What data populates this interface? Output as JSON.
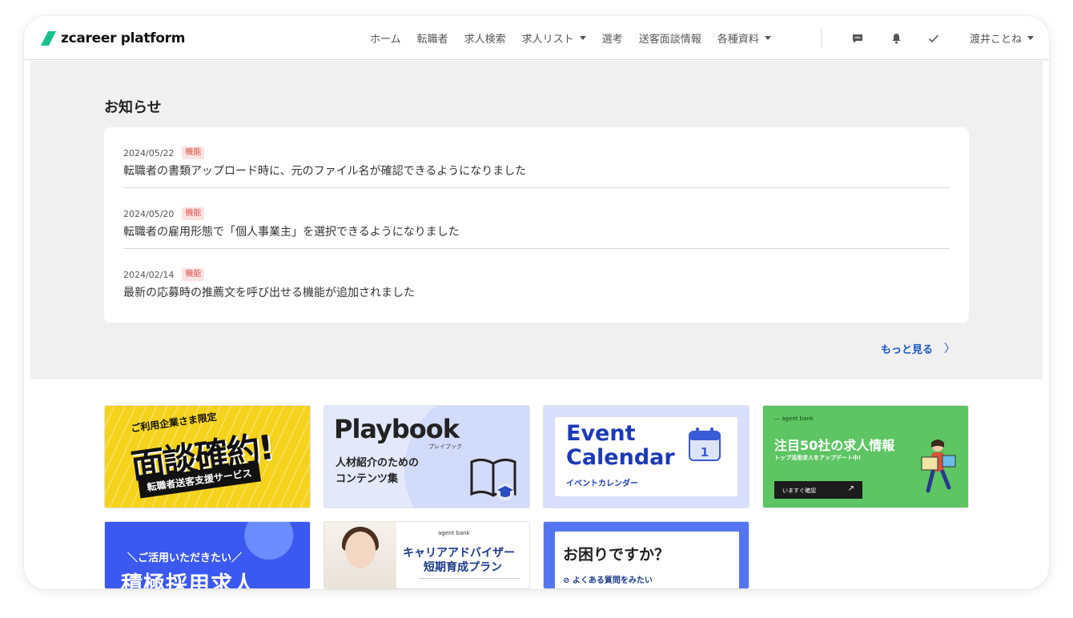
{
  "header": {
    "logo_text": "zcareer platform",
    "nav": [
      "ホーム",
      "転職者",
      "求人検索",
      "求人リスト",
      "選考",
      "送客面談情報",
      "各種資料"
    ],
    "user_name": "渡井ことね",
    "icons": [
      "chat-icon",
      "bell-icon",
      "check-icon"
    ]
  },
  "notices": {
    "title": "お知らせ",
    "items": [
      {
        "date": "2024/05/22",
        "tag": "機能",
        "title": "転職者の書類アップロード時に、元のファイル名が確認できるようになりました"
      },
      {
        "date": "2024/05/20",
        "tag": "機能",
        "title": "転職者の雇用形態で「個人事業主」を選択できるようになりました"
      },
      {
        "date": "2024/02/14",
        "tag": "機能",
        "title": "最新の応募時の推薦文を呼び出せる機能が追加されました"
      }
    ],
    "more_label": "もっと見る",
    "more_chevron": "〉"
  },
  "banners": {
    "b1": {
      "small": "ご利用企業さま限定",
      "big": "面談確約!",
      "ribbon": "転職者送客支援サービス"
    },
    "b2": {
      "title": "Playbook",
      "kana": "プレイブック",
      "sub1": "人材紹介のための",
      "sub2": "コンテンツ集"
    },
    "b3": {
      "line1": "Event",
      "line2": "Calendar",
      "sub": "イベントカレンダー",
      "cal_day": "1"
    },
    "b4": {
      "agent": "— agent bank",
      "title": "注目50社の求人情報",
      "sub": "トップ活用求人をアップデート中!",
      "button": "いますぐ確認",
      "arrow": "↗"
    },
    "b5": {
      "small": "＼ご活用いただきたい／",
      "big": "積極採用求人"
    },
    "b6": {
      "agent": "agent bank",
      "t1": "キャリアアドバイザー",
      "t2": "短期育成プラン"
    },
    "b7": {
      "q": "お困りですか？",
      "faq": "よくある質問をみたい"
    }
  },
  "colors": {
    "accent_blue": "#1a56c4",
    "logo_green": "#17c28f",
    "tag_red": "#d9534f"
  }
}
